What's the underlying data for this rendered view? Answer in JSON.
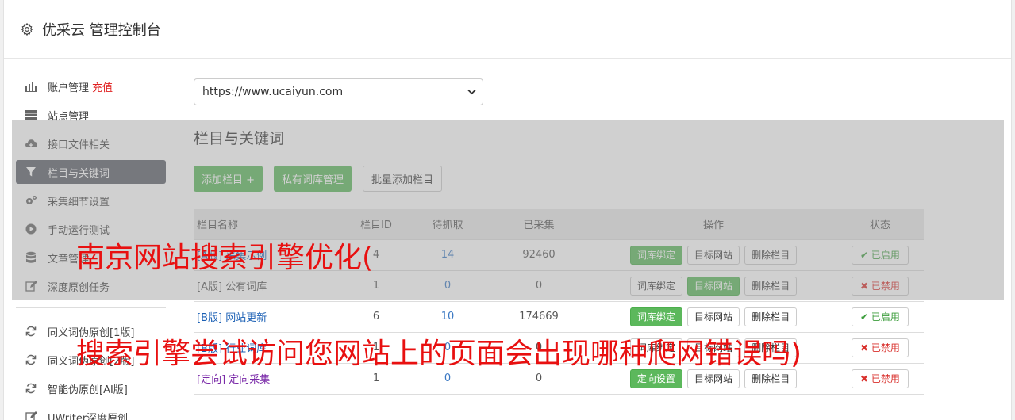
{
  "header": {
    "title": "优采云 管理控制台"
  },
  "sidebar": {
    "items": [
      {
        "label": "账户管理",
        "badge": "充值",
        "icon": "bar-chart-icon"
      },
      {
        "label": "站点管理",
        "icon": "server-icon"
      },
      {
        "label": "接口文件相关",
        "icon": "cloud-download-icon"
      },
      {
        "label": "栏目与关键词",
        "icon": "filter-icon"
      },
      {
        "label": "采集细节设置",
        "icon": "cogs-icon"
      },
      {
        "label": "手动运行测试",
        "icon": "play-circle-icon"
      },
      {
        "label": "文章管理",
        "icon": "database-icon"
      },
      {
        "label": "深度原创任务",
        "icon": "edit-icon"
      }
    ],
    "items2": [
      {
        "label": "同义词伪原创[1版]",
        "icon": "refresh-icon"
      },
      {
        "label": "同义词伪原创[2版]",
        "icon": "refresh-icon"
      },
      {
        "label": "智能伪原创[AI版]",
        "icon": "refresh-icon"
      },
      {
        "label": "UWriter深度原创",
        "icon": "edit-icon"
      }
    ]
  },
  "main": {
    "site_select": "https://www.ucaiyun.com",
    "section_title": "栏目与关键词",
    "buttons": {
      "add": "添加栏目 +",
      "lexicon": "私有词库管理",
      "batch": "批量添加栏目"
    },
    "table": {
      "headers": [
        "栏目名称",
        "栏目ID",
        "待抓取",
        "已采集",
        "操作",
        "状态"
      ],
      "rows": [
        {
          "tag": "[A版]",
          "name": "采集示例",
          "id": "4",
          "wait": "14",
          "done": "92460",
          "op1": "词库绑定",
          "op2": "目标网站",
          "op3": "删除栏目",
          "status": "已启用"
        },
        {
          "tag": "[A版]",
          "name": "公有词库",
          "id": "1",
          "wait": "0",
          "done": "0",
          "op1": "词库绑定",
          "op2": "目标网站",
          "op3": "删除栏目",
          "status": "已禁用"
        },
        {
          "tag": "[B版]",
          "name": "网站更新",
          "id": "6",
          "wait": "10",
          "done": "174669",
          "op1": "词库绑定",
          "op2": "目标网站",
          "op3": "删除栏目",
          "status": "已启用"
        },
        {
          "tag": "[B版]",
          "name": "行业词库",
          "id": "1",
          "wait": "0",
          "done": "0",
          "op1": "词库绑定",
          "op2": "目标网站",
          "op3": "删除栏目",
          "status": "已禁用"
        },
        {
          "tag": "[定向]",
          "name": "定向采集",
          "id": "1",
          "wait": "0",
          "done": "0",
          "op1": "定向设置",
          "op2": "目标网站",
          "op3": "删除栏目",
          "status": "已禁用"
        }
      ]
    }
  },
  "watermark": {
    "line1": "南京网站搜索引擎优化(",
    "line2": "搜索引擎尝试访问您网站上的页面会出现哪种爬网错误吗)"
  }
}
